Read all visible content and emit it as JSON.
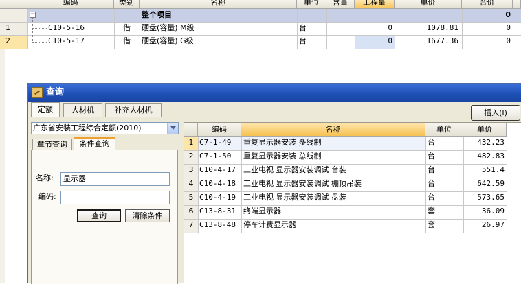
{
  "top_table": {
    "columns": [
      "编码",
      "类别",
      "名称",
      "单位",
      "含量",
      "工程量",
      "单价",
      "合价"
    ],
    "summary_row": {
      "expander": "−",
      "name": "整个项目",
      "total": "0"
    },
    "rows": [
      {
        "num": "1",
        "code": "C10-5-16",
        "category": "借",
        "name": "硬盘(容量) M级",
        "unit": "台",
        "quantity": "0",
        "price": "1078.81",
        "total": "0"
      },
      {
        "num": "2",
        "code": "C10-5-17",
        "category": "借",
        "name": "硬盘(容量) G级",
        "unit": "台",
        "quantity": "0",
        "price": "1677.36",
        "total": "0"
      }
    ]
  },
  "dialog": {
    "title": "查询",
    "tabs": [
      "定额",
      "人材机",
      "补充人材机"
    ],
    "insert_button": "插入(I)",
    "quota_library": "广东省安装工程综合定额(2010)",
    "subtabs": [
      "章节查询",
      "条件查询"
    ],
    "name_label": "名称:",
    "name_value": "显示器",
    "code_label": "编码:",
    "code_value": "",
    "search_button": "查询",
    "clear_button": "清除条件",
    "results": {
      "columns": [
        "编码",
        "名称",
        "单位",
        "单价"
      ],
      "rows": [
        {
          "num": "1",
          "code": "C7-1-49",
          "name": "重复显示器安装 多线制",
          "unit": "台",
          "price": "432.23"
        },
        {
          "num": "2",
          "code": "C7-1-50",
          "name": "重复显示器安装 总线制",
          "unit": "台",
          "price": "482.83"
        },
        {
          "num": "3",
          "code": "C10-4-17",
          "name": "工业电视 显示器安装调试 台装",
          "unit": "台",
          "price": "551.4"
        },
        {
          "num": "4",
          "code": "C10-4-18",
          "name": "工业电视 显示器安装调试 棚顶吊装",
          "unit": "台",
          "price": "642.59"
        },
        {
          "num": "5",
          "code": "C10-4-19",
          "name": "工业电视 显示器安装调试 盘装",
          "unit": "台",
          "price": "573.65"
        },
        {
          "num": "6",
          "code": "C13-8-31",
          "name": "终端显示器",
          "unit": "套",
          "price": "36.09"
        },
        {
          "num": "7",
          "code": "C13-8-48",
          "name": "停车计费显示器",
          "unit": "套",
          "price": "26.97"
        }
      ]
    }
  },
  "colors": {
    "title_bar": "#1e4fb4",
    "summary_row": "#c6cfe6",
    "selected_header": "#f5c152",
    "dialog_bg": "#ece9d8"
  }
}
